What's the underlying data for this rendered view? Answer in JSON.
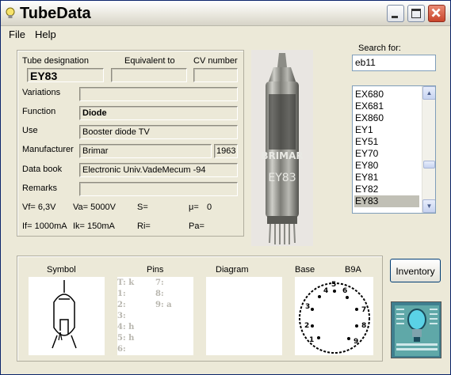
{
  "window": {
    "title": "TubeData"
  },
  "menu": {
    "file": "File",
    "help": "Help"
  },
  "details": {
    "designation_label": "Tube designation",
    "designation_value": "EY83",
    "equivalent_label": "Equivalent to",
    "equivalent_value": "",
    "cv_label": "CV number",
    "cv_value": "",
    "variations_label": "Variations",
    "variations_value": "",
    "function_label": "Function",
    "function_value": "Diode",
    "use_label": "Use",
    "use_value": "Booster diode TV",
    "manufacturer_label": "Manufacturer",
    "manufacturer_value": "Brimar",
    "year_value": "1963",
    "databook_label": "Data book",
    "databook_value": "Electronic Univ.VadeMecum -94",
    "remarks_label": "Remarks",
    "remarks_value": ""
  },
  "ratings": {
    "vf": "Vf= 6,3V",
    "va": "Va= 5000V",
    "s": "S=",
    "mu": "μ=",
    "mu_value": "0",
    "if": "If= 1000mA",
    "ik": "Ik= 150mA",
    "ri": "Ri=",
    "pa": "Pa="
  },
  "search": {
    "label": "Search for:",
    "value": "eb11",
    "list": [
      "EX680",
      "EX681",
      "EX860",
      "EY1",
      "EY51",
      "EY70",
      "EY80",
      "EY81",
      "EY82",
      "EY83"
    ],
    "selected": "EY83"
  },
  "bottom": {
    "symbol_label": "Symbol",
    "pins_label": "Pins",
    "diagram_label": "Diagram",
    "base_label": "Base",
    "base_value": "B9A",
    "pins_col1": [
      "T: k",
      "1:",
      "2:",
      "3:",
      "4: h",
      "5: h",
      "6:"
    ],
    "pins_col2": [
      "7:",
      "8:",
      "9: a"
    ],
    "socket_numbers": [
      "1",
      "2",
      "3",
      "4",
      "5",
      "6",
      "7",
      "8",
      "9"
    ]
  },
  "inventory_button": "Inventory",
  "tube_photo": {
    "brand": "BRIMAR",
    "type": "EY83"
  },
  "icons": [
    "bulb-icon",
    "minimize-icon",
    "maximize-icon",
    "close-icon",
    "scroll-up-icon",
    "scroll-down-icon"
  ]
}
